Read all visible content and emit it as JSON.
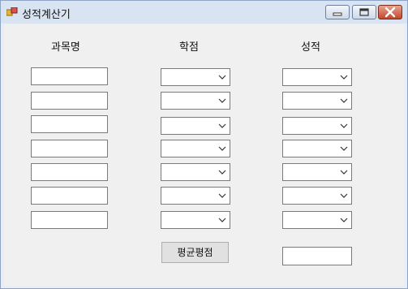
{
  "window": {
    "title": "성적계산기"
  },
  "headers": {
    "subject": "과목명",
    "credit": "학점",
    "grade": "성적"
  },
  "rows": [
    {
      "subject": "",
      "credit": "",
      "grade": ""
    },
    {
      "subject": "",
      "credit": "",
      "grade": ""
    },
    {
      "subject": "",
      "credit": "",
      "grade": ""
    },
    {
      "subject": "",
      "credit": "",
      "grade": ""
    },
    {
      "subject": "",
      "credit": "",
      "grade": ""
    },
    {
      "subject": "",
      "credit": "",
      "grade": ""
    },
    {
      "subject": "",
      "credit": "",
      "grade": ""
    }
  ],
  "actions": {
    "average_label": "평균평점"
  },
  "result": {
    "value": ""
  },
  "icons": {
    "app": "app-icon",
    "minimize": "minimize-icon",
    "maximize": "maximize-icon",
    "close": "close-icon",
    "dropdown": "chevron-down-icon"
  }
}
